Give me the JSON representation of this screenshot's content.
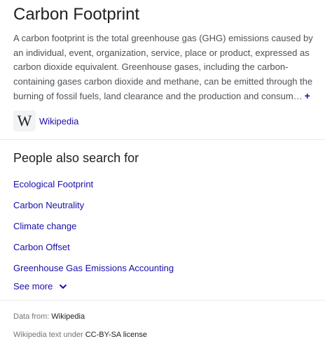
{
  "panel": {
    "title": "Carbon Footprint",
    "description": "A carbon footprint is the total greenhouse gas (GHG) emissions caused by an individual, event, organization, service, place or product, expressed as carbon dioxide equivalent. Greenhouse gases, including the carbon-containing gases carbon dioxide and methane, can be emitted through the burning of fossil fuels, land clearance and the production and consum…",
    "expand_glyph": "+",
    "source_logo": "W",
    "source_label": "Wikipedia"
  },
  "related": {
    "heading": "People also search for",
    "items": [
      {
        "label": "Ecological Footprint"
      },
      {
        "label": "Carbon Neutrality"
      },
      {
        "label": "Climate change"
      },
      {
        "label": "Carbon Offset"
      },
      {
        "label": "Greenhouse Gas Emissions Accounting"
      }
    ],
    "see_more": "See more"
  },
  "footer": {
    "data_from_prefix": "Data from: ",
    "data_from_link": "Wikipedia",
    "license_prefix": "Wikipedia text under ",
    "license_link": "CC-BY-SA license"
  },
  "colors": {
    "link": "#1a0dab",
    "text": "#202124",
    "muted": "#4d5156",
    "divider": "#e8eaed"
  }
}
